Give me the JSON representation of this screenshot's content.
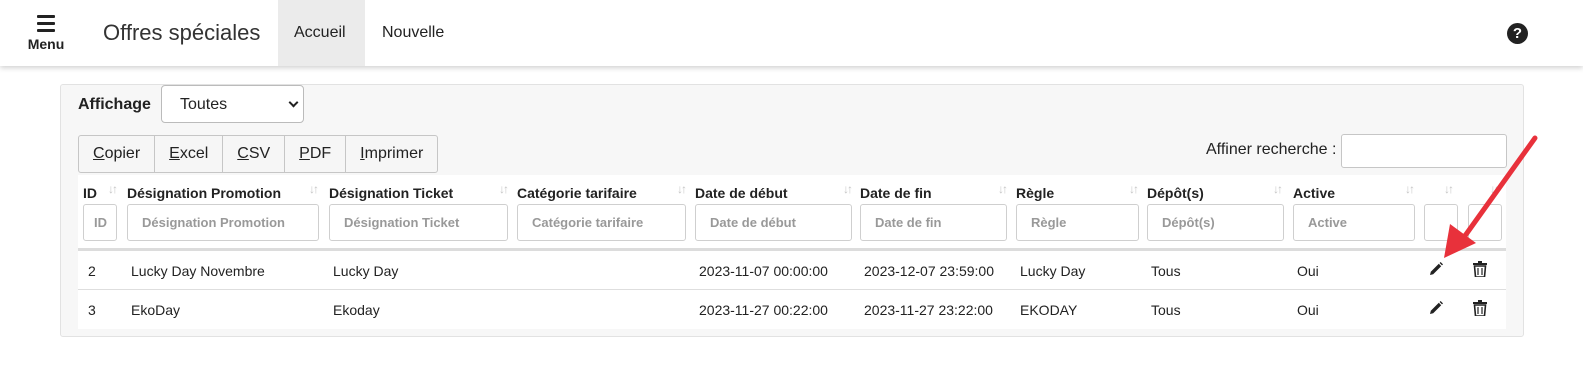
{
  "navbar": {
    "menu_label": "Menu",
    "app_title": "Offres spéciales",
    "tabs": [
      {
        "label": "Accueil",
        "active": true
      },
      {
        "label": "Nouvelle",
        "active": false
      }
    ],
    "help_icon": "question-circle-icon",
    "help_glyph": "?"
  },
  "filter_bar": {
    "affichage_label": "Affichage",
    "affichage_value": "Toutes"
  },
  "export_buttons": [
    {
      "accel": "C",
      "rest": "opier"
    },
    {
      "accel": "E",
      "rest": "xcel"
    },
    {
      "accel": "C",
      "rest": "SV"
    },
    {
      "accel": "P",
      "rest": "DF"
    },
    {
      "accel": "I",
      "rest": "mprimer"
    }
  ],
  "search": {
    "label": "Affiner recherche :",
    "value": ""
  },
  "table": {
    "columns": [
      {
        "label": "ID",
        "placeholder": "ID"
      },
      {
        "label": "Désignation Promotion",
        "placeholder": "Désignation Promotion"
      },
      {
        "label": "Désignation Ticket",
        "placeholder": "Désignation Ticket"
      },
      {
        "label": "Catégorie tarifaire",
        "placeholder": "Catégorie tarifaire"
      },
      {
        "label": "Date de début",
        "placeholder": "Date de début"
      },
      {
        "label": "Date de fin",
        "placeholder": "Date de fin"
      },
      {
        "label": "Règle",
        "placeholder": "Règle"
      },
      {
        "label": "Dépôt(s)",
        "placeholder": "Dépôt(s)"
      },
      {
        "label": "Active",
        "placeholder": "Active"
      },
      {
        "label": "",
        "placeholder": ""
      },
      {
        "label": "",
        "placeholder": ""
      }
    ],
    "sort_glyph": "↓↑",
    "rows": [
      {
        "id": "2",
        "promotion": "Lucky Day Novembre",
        "ticket": "Lucky Day",
        "categorie": "",
        "debut": "2023-11-07 00:00:00",
        "fin": "2023-12-07 23:59:00",
        "regle": "Lucky Day",
        "depots": "Tous",
        "active": "Oui"
      },
      {
        "id": "3",
        "promotion": "EkoDay",
        "ticket": "Ekoday",
        "categorie": "",
        "debut": "2023-11-27 00:22:00",
        "fin": "2023-11-27 23:22:00",
        "regle": "EKODAY",
        "depots": "Tous",
        "active": "Oui"
      }
    ],
    "row_actions": [
      "pencil-edit-icon",
      "trash-delete-icon"
    ]
  },
  "annotation": {
    "arrow_color": "#e8313b"
  }
}
